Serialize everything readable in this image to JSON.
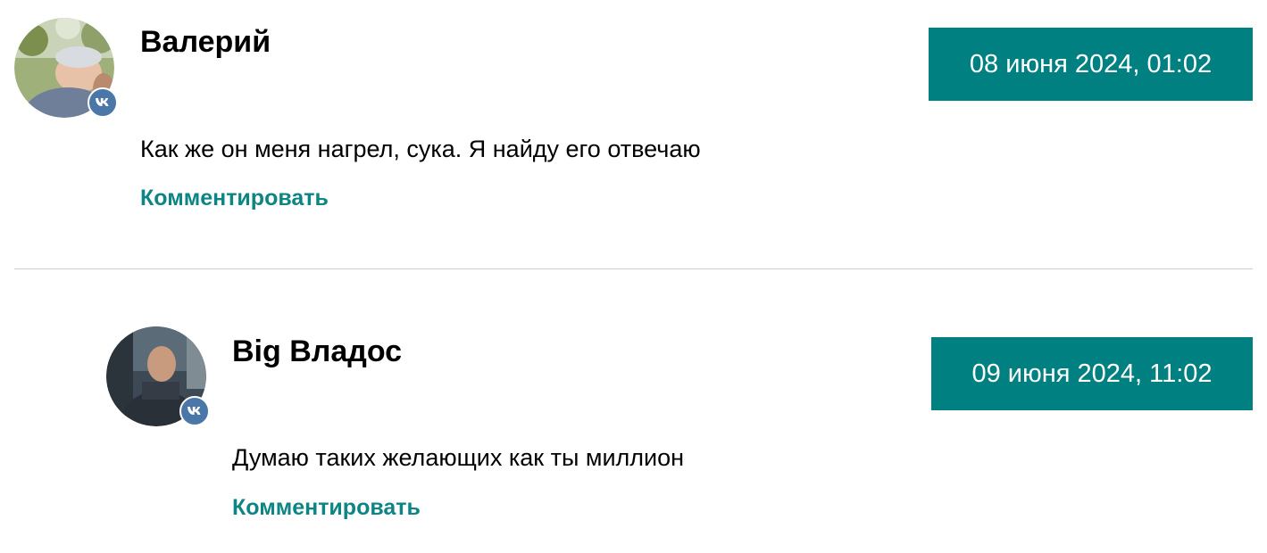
{
  "comments": [
    {
      "author": "Валерий",
      "date": "08 июня 2024, 01:02",
      "text": "Как же он меня нагрел, сука. Я найду его отвечаю",
      "reply_label": "Комментировать",
      "avatar_icon": "user-photo",
      "badge_icon": "vk-icon"
    },
    {
      "author": "Big Владос",
      "date": "09 июня 2024, 11:02",
      "text": "Думаю таких желающих как ты миллион",
      "reply_label": "Комментировать",
      "avatar_icon": "user-photo",
      "badge_icon": "vk-icon"
    }
  ],
  "colors": {
    "accent": "#008080",
    "link": "#0e8585",
    "vk_badge": "#4a76a8",
    "divider": "#cfcfcf"
  }
}
